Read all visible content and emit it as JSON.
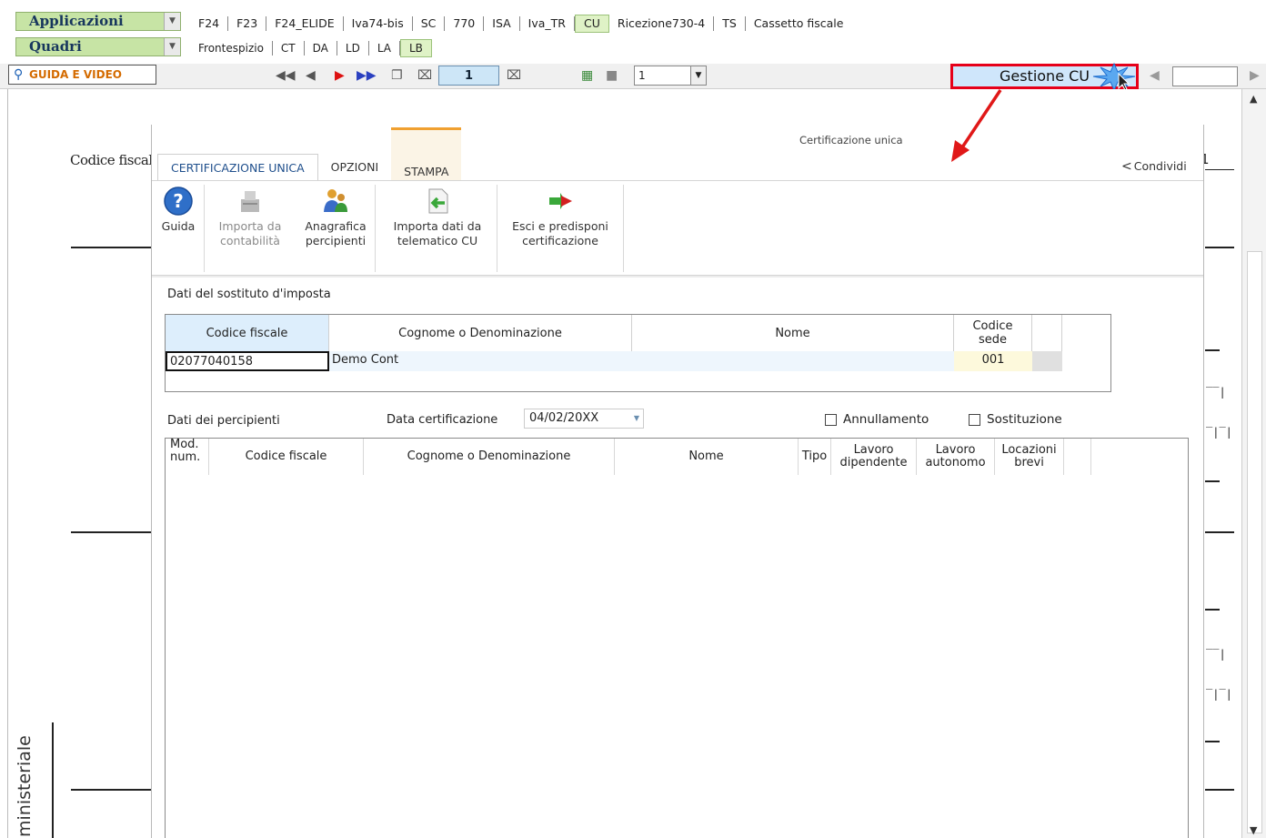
{
  "menu": {
    "applicazioni": "Applicazioni",
    "quadri": "Quadri",
    "apps": [
      "F24",
      "F23",
      "F24_ELIDE",
      "Iva74-bis",
      "SC",
      "770",
      "ISA",
      "Iva_TR",
      "CU",
      "Ricezione730-4",
      "TS",
      "Cassetto fiscale"
    ],
    "active_app": "CU",
    "quadri_items": [
      "Frontespizio",
      "CT",
      "DA",
      "LD",
      "LA",
      "LB"
    ],
    "active_quadro": "LB"
  },
  "toolbar": {
    "guida_video": "GUIDA E VIDEO",
    "page_number": "1",
    "combo_value": "1",
    "gestione_cu": "Gestione CU"
  },
  "background": {
    "codice_fiscale": "Codice fiscal",
    "number_one": "1",
    "ministeriale": "ministeriale"
  },
  "dialog": {
    "title": "Certificazione unica",
    "share": "Condividi",
    "tabs": [
      "CERTIFICAZIONE UNICA",
      "OPZIONI",
      "STAMPA"
    ],
    "buttons": [
      {
        "line1": "Guida",
        "line2": ""
      },
      {
        "line1": "Importa da",
        "line2": "contabilità"
      },
      {
        "line1": "Anagrafica",
        "line2": "percipienti"
      },
      {
        "line1": "Importa dati da",
        "line2": "telematico CU"
      },
      {
        "line1": "Esci e predisponi",
        "line2": "certificazione"
      }
    ],
    "sostituto": {
      "label": "Dati del sostituto d'imposta",
      "headers": {
        "cf": "Codice fiscale",
        "cognome": "Cognome o Denominazione",
        "nome": "Nome",
        "sede_1": "Codice",
        "sede_2": "sede"
      },
      "row": {
        "cf": "02077040158",
        "cognome": "Demo Cont",
        "nome": "",
        "sede": "001"
      }
    },
    "percipienti": {
      "label": "Dati dei percipienti",
      "data_label": "Data certificazione",
      "data_value": "04/02/20XX",
      "annullamento": "Annullamento",
      "sostituzione": "Sostituzione",
      "headers": {
        "mod_1": "Mod.",
        "mod_2": "num.",
        "cf": "Codice fiscale",
        "cognome": "Cognome o Denominazione",
        "nome": "Nome",
        "tipo": "Tipo",
        "dip_1": "Lavoro",
        "dip_2": "dipendente",
        "aut_1": "Lavoro",
        "aut_2": "autonomo",
        "loc_1": "Locazioni",
        "loc_2": "brevi"
      }
    }
  },
  "colors": {
    "accent_green": "#c7e4a5",
    "highlight_red": "#e6001a",
    "stampa_orange": "#f0a030",
    "header_blue": "#ddeefc"
  }
}
